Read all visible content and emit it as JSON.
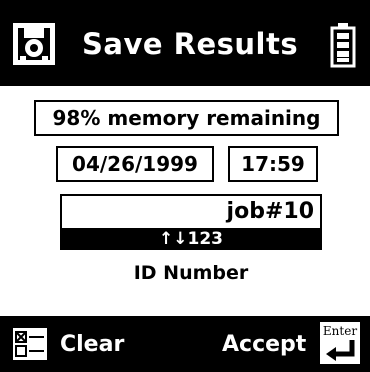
{
  "header": {
    "title": "Save Results",
    "left_icon": "save-disk-icon",
    "right_icon": "battery-icon"
  },
  "status": {
    "memory": "98% memory remaining",
    "date": "04/26/1999",
    "time": "17:59"
  },
  "id_field": {
    "value": "job#10",
    "mode": "↑↓123",
    "label": "ID Number"
  },
  "softkeys": {
    "clear_label": "Clear",
    "accept_label": "Accept",
    "enter_label": "Enter",
    "clear_icon": "checkbox-list-icon",
    "enter_icon": "enter-key-icon"
  },
  "colors": {
    "background": "#ffffff",
    "foreground": "#000000"
  }
}
